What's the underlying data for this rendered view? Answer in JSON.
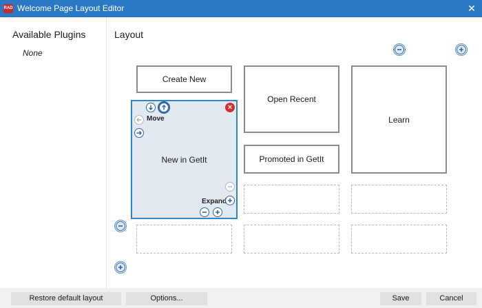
{
  "window": {
    "title": "Welcome Page Layout Editor",
    "app_badge": "RAD",
    "close_glyph": "✕"
  },
  "left_panel": {
    "heading": "Available Plugins",
    "empty_text": "None"
  },
  "layout": {
    "heading": "Layout",
    "tiles": {
      "create_new": "Create New",
      "open_recent": "Open Recent",
      "learn": "Learn",
      "new_in_getit": "New in GetIt",
      "promoted_in_getit": "Promoted in GetIt"
    },
    "controls": {
      "move_label": "Move",
      "expand_label": "Expand"
    }
  },
  "footer": {
    "restore_label": "Restore default layout",
    "options_label": "Options...",
    "save_label": "Save",
    "cancel_label": "Cancel"
  },
  "colors": {
    "titlebar": "#2b78c5",
    "selected_border": "#2e86c9",
    "selected_fill": "#e2e9f1",
    "delete_red": "#d32f2f",
    "icon_blue": "#2e66a8"
  },
  "icons": [
    "app-icon",
    "close-icon",
    "minus-icon",
    "plus-icon",
    "arrow-down-icon",
    "arrow-up-icon",
    "arrow-left-icon",
    "arrow-right-icon",
    "delete-icon"
  ]
}
